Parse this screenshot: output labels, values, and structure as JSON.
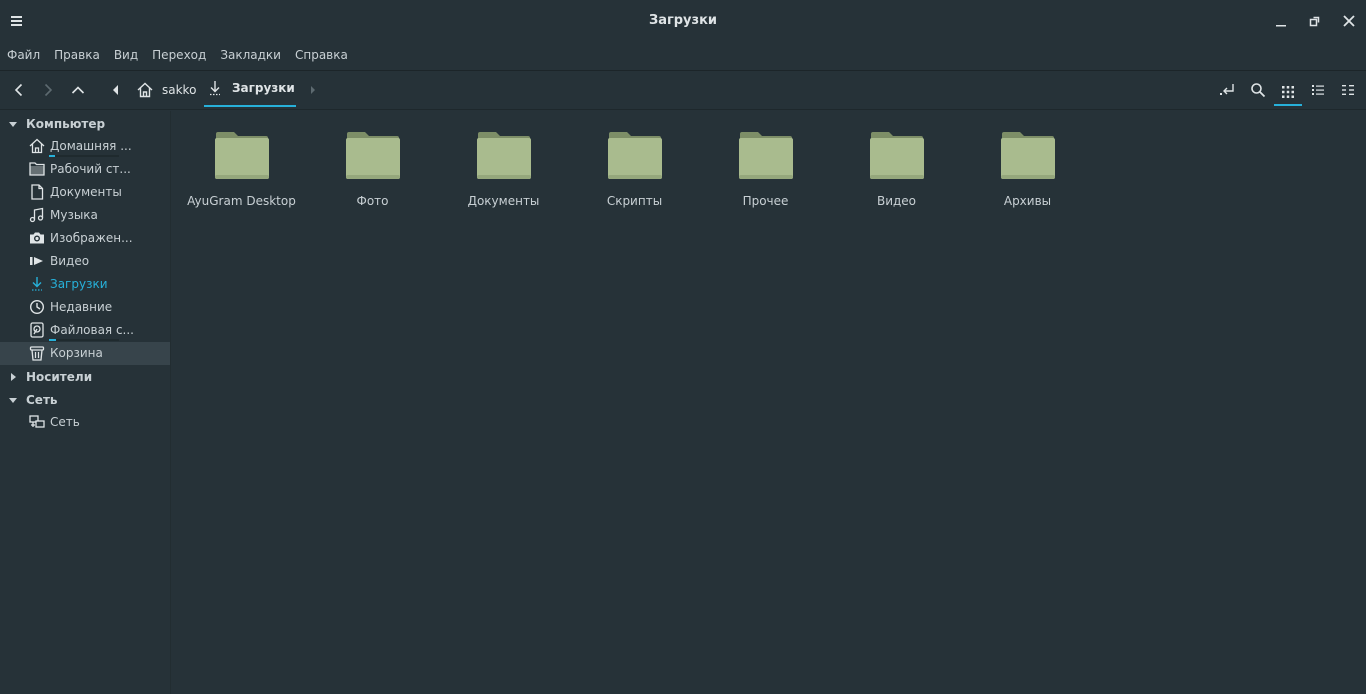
{
  "window": {
    "title": "Загрузки"
  },
  "menubar": {
    "items": [
      "Файл",
      "Правка",
      "Вид",
      "Переход",
      "Закладки",
      "Справка"
    ]
  },
  "breadcrumb": {
    "home": "sakko",
    "current": "Загрузки"
  },
  "sidebar": {
    "sections": {
      "computer": "Компьютер",
      "devices": "Носители",
      "network": "Сеть"
    },
    "items": [
      {
        "label": "Домашняя ...",
        "icon": "home-icon"
      },
      {
        "label": "Рабочий ст...",
        "icon": "folder-icon"
      },
      {
        "label": "Документы",
        "icon": "document-icon"
      },
      {
        "label": "Музыка",
        "icon": "music-icon"
      },
      {
        "label": "Изображен...",
        "icon": "camera-icon"
      },
      {
        "label": "Видео",
        "icon": "video-icon"
      },
      {
        "label": "Загрузки",
        "icon": "download-icon"
      },
      {
        "label": "Недавние",
        "icon": "clock-icon"
      },
      {
        "label": "Файловая с...",
        "icon": "filesystem-icon"
      },
      {
        "label": "Корзина",
        "icon": "trash-icon"
      }
    ],
    "network_items": [
      {
        "label": "Сеть",
        "icon": "network-icon"
      }
    ]
  },
  "folders": [
    {
      "name": "AyuGram Desktop"
    },
    {
      "name": "Фото"
    },
    {
      "name": "Документы"
    },
    {
      "name": "Скрипты"
    },
    {
      "name": "Прочее"
    },
    {
      "name": "Видео"
    },
    {
      "name": "Архивы"
    }
  ],
  "colors": {
    "background": "#263238",
    "accent": "#27b0d9",
    "folder": "#a9bb8e",
    "selected_row": "#37444b"
  },
  "storage_usage": {
    "home": 0.08,
    "filesystem": 0.1
  }
}
